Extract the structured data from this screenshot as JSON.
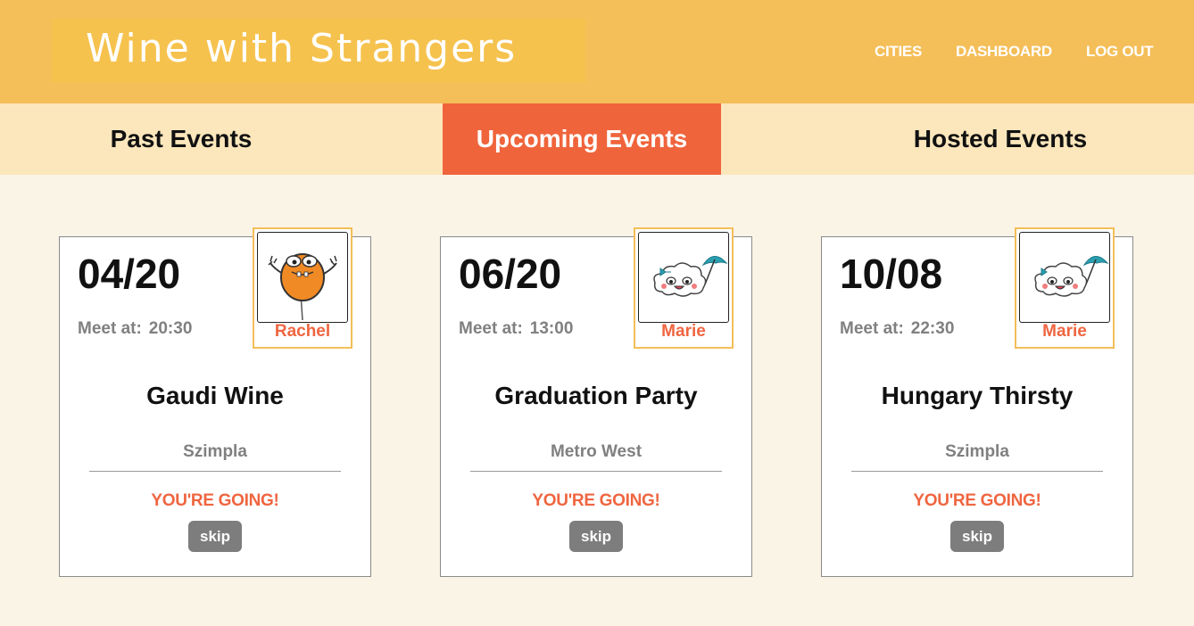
{
  "app": {
    "title": "Wine with Strangers"
  },
  "nav": {
    "items": [
      "CITIES",
      "DASHBOARD",
      "LOG OUT"
    ]
  },
  "tabs": {
    "items": [
      "Past Events",
      "Upcoming Events",
      "Hosted Events"
    ],
    "active": "Upcoming Events"
  },
  "colors": {
    "header": "#f4be58",
    "accent": "#f0643c",
    "tab_bar": "#fce7bc",
    "background": "#faf4e6"
  },
  "events": [
    {
      "date": "04/20",
      "meet_label": "Meet at:",
      "time": "20:30",
      "host": "Rachel",
      "host_avatar_icon": "orange-monster-icon",
      "name": "Gaudi Wine",
      "venue": "Szimpla",
      "status": "YOU'RE GOING!",
      "action": "skip"
    },
    {
      "date": "06/20",
      "meet_label": "Meet at:",
      "time": "13:00",
      "host": "Marie",
      "host_avatar_icon": "cloud-umbrella-icon",
      "name": "Graduation Party",
      "venue": "Metro West",
      "status": "YOU'RE GOING!",
      "action": "skip"
    },
    {
      "date": "10/08",
      "meet_label": "Meet at:",
      "time": "22:30",
      "host": "Marie",
      "host_avatar_icon": "cloud-umbrella-icon",
      "name": "Hungary Thirsty",
      "venue": "Szimpla",
      "status": "YOU'RE GOING!",
      "action": "skip"
    }
  ]
}
